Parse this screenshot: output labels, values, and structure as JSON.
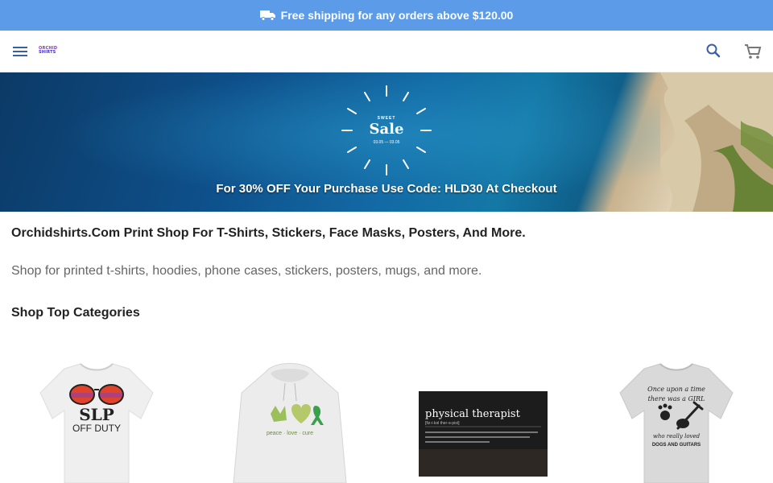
{
  "promo": {
    "text": "Free shipping for any orders above $120.00",
    "icon": "truck-icon"
  },
  "header": {
    "logo_line1": "ORCHID",
    "logo_line2": "SHIRTS",
    "menu_icon": "menu-icon",
    "search_icon": "search-icon",
    "cart_icon": "cart-icon"
  },
  "hero": {
    "sale_small": "SWEET",
    "sale_big": "Sale",
    "sale_dates": "03.05 — 03.05",
    "caption": "For 30% OFF Your Purchase Use Code: HLD30 At Checkout"
  },
  "intro": {
    "title": "Orchidshirts.Com Print Shop For T-Shirts, Stickers, Face Masks, Posters, And More.",
    "text": "Shop for printed t-shirts, hoodies, phone cases, stickers, posters, mugs, and more."
  },
  "categories": {
    "title": "Shop Top Categories",
    "items": [
      {
        "print_line1": "SLP",
        "print_line2": "OFF DUTY"
      },
      {
        "print_line1": "peace · love · cure"
      },
      {
        "print_line1": "physical therapist",
        "print_line2": "[fiz-i-kəl ther-ə-pist]"
      },
      {
        "print_line1": "Once upon a time",
        "print_line2": "there was a GIRL",
        "print_line3": "who really loved",
        "print_line4": "DOGS AND GUITARS"
      }
    ]
  },
  "colors": {
    "promo_bg": "#5b9be8",
    "brand_purple": "#8b2be2",
    "brand_blue": "#3a2bd9"
  }
}
